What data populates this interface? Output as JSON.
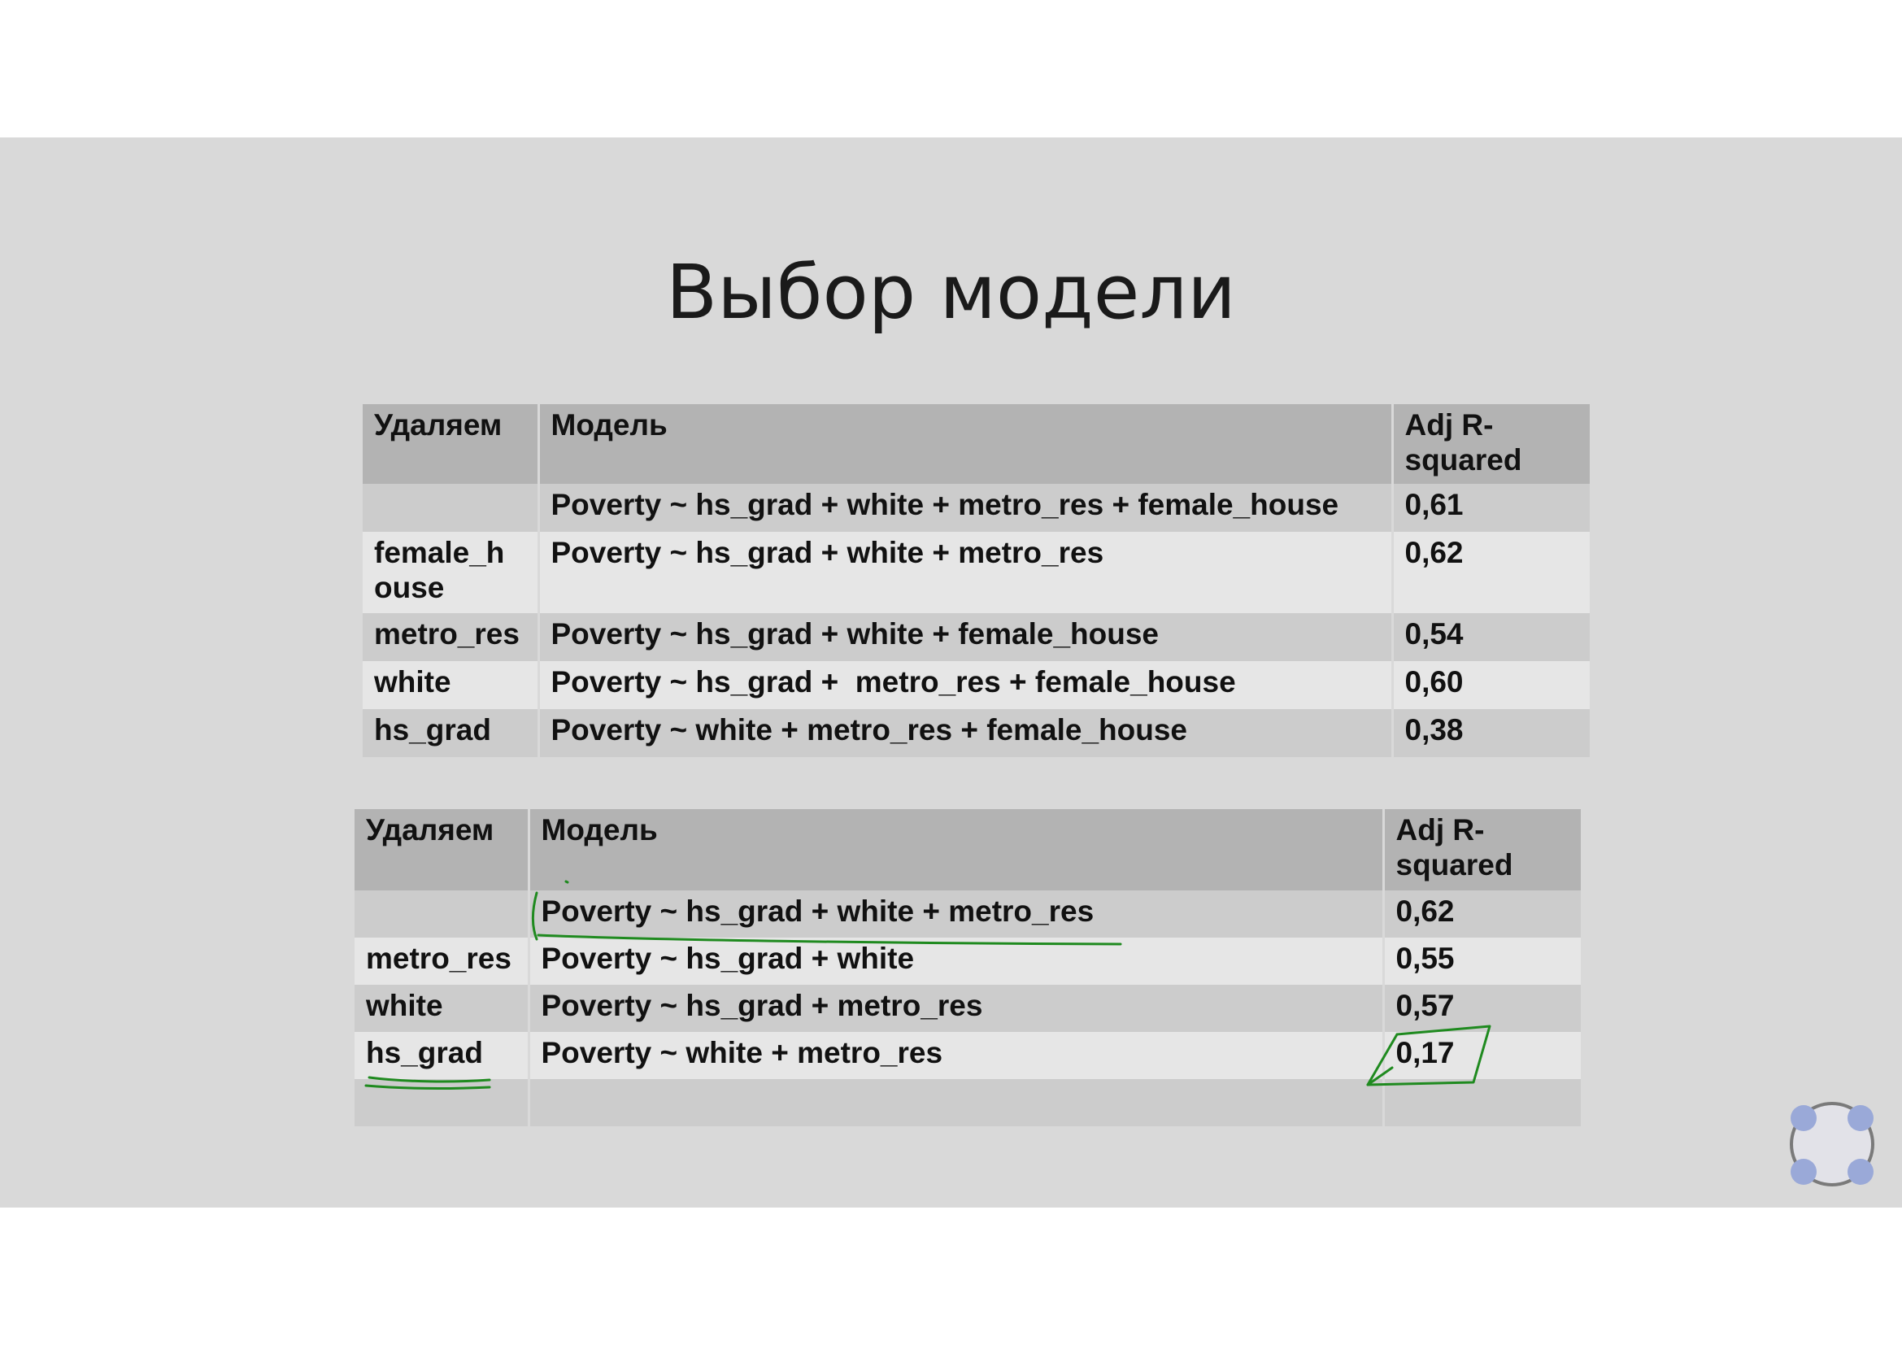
{
  "slide": {
    "title": "Выбор модели"
  },
  "table_1": {
    "headers": [
      "Удаляем",
      "Модель",
      "Adj R-\nsquared"
    ],
    "rows": [
      [
        "",
        "Poverty ~ hs_grad + white + metro_res + female_house",
        "0,61"
      ],
      [
        "female_h\nouse",
        "Poverty ~ hs_grad + white + metro_res",
        "0,62"
      ],
      [
        "metro_res",
        "Poverty ~ hs_grad + white + female_house",
        "0,54"
      ],
      [
        "white",
        "Poverty ~ hs_grad +  metro_res + female_house",
        "0,60"
      ],
      [
        "hs_grad",
        "Poverty ~ white + metro_res + female_house",
        "0,38"
      ]
    ]
  },
  "table_2": {
    "headers": [
      "Удаляем",
      "Модель",
      "Adj R-\nsquared"
    ],
    "rows": [
      [
        "",
        "Poverty ~ hs_grad + white + metro_res",
        "0,62"
      ],
      [
        "metro_res",
        "Poverty ~ hs_grad + white",
        "0,55"
      ],
      [
        "white",
        "Poverty ~ hs_grad + metro_res",
        "0,57"
      ],
      [
        "hs_grad",
        "Poverty ~ white + metro_res",
        "0,17"
      ],
      [
        "",
        "",
        ""
      ]
    ]
  },
  "annotations": {
    "ink_color": "#1f8a1f",
    "marks": [
      "underline-model-row-1",
      "underline-hs_grad",
      "box-0,17"
    ]
  },
  "colors": {
    "slide_bg": "#d9d9d9",
    "header_bg": "#b3b3b3",
    "row_dark": "#cccccc",
    "row_light": "#e6e6e6"
  }
}
